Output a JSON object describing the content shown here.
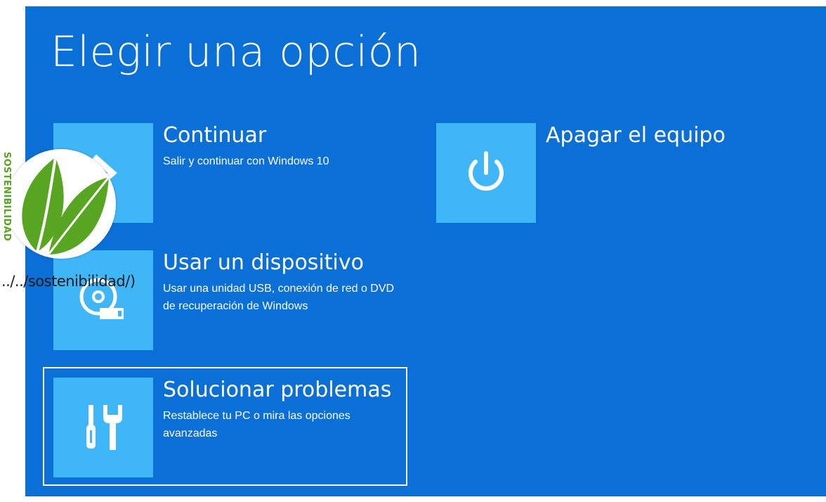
{
  "screen": {
    "title": "Elegir una opción"
  },
  "options": [
    {
      "title": "Continuar",
      "description": "Salir y continuar con Windows 10",
      "icon": "arrow-right-icon"
    },
    {
      "title": "Usar un dispositivo",
      "description": "Usar una unidad USB, conexión de red o DVD de recuperación de Windows",
      "icon": "disc-usb-icon"
    },
    {
      "title": "Solucionar problemas",
      "description": "Restablece tu PC o mira las opciones avanzadas",
      "icon": "tools-icon"
    },
    {
      "title": "Apagar el equipo",
      "description": "",
      "icon": "power-icon"
    }
  ],
  "overlay": {
    "badge_text": "SOSTENIBILIDAD",
    "link_text": "../../sostenibilidad/)",
    "badge_color": "#58a521",
    "icon": "leaf-icon"
  },
  "colors": {
    "background": "#0b6fd8",
    "tile": "#3fb6f8"
  }
}
